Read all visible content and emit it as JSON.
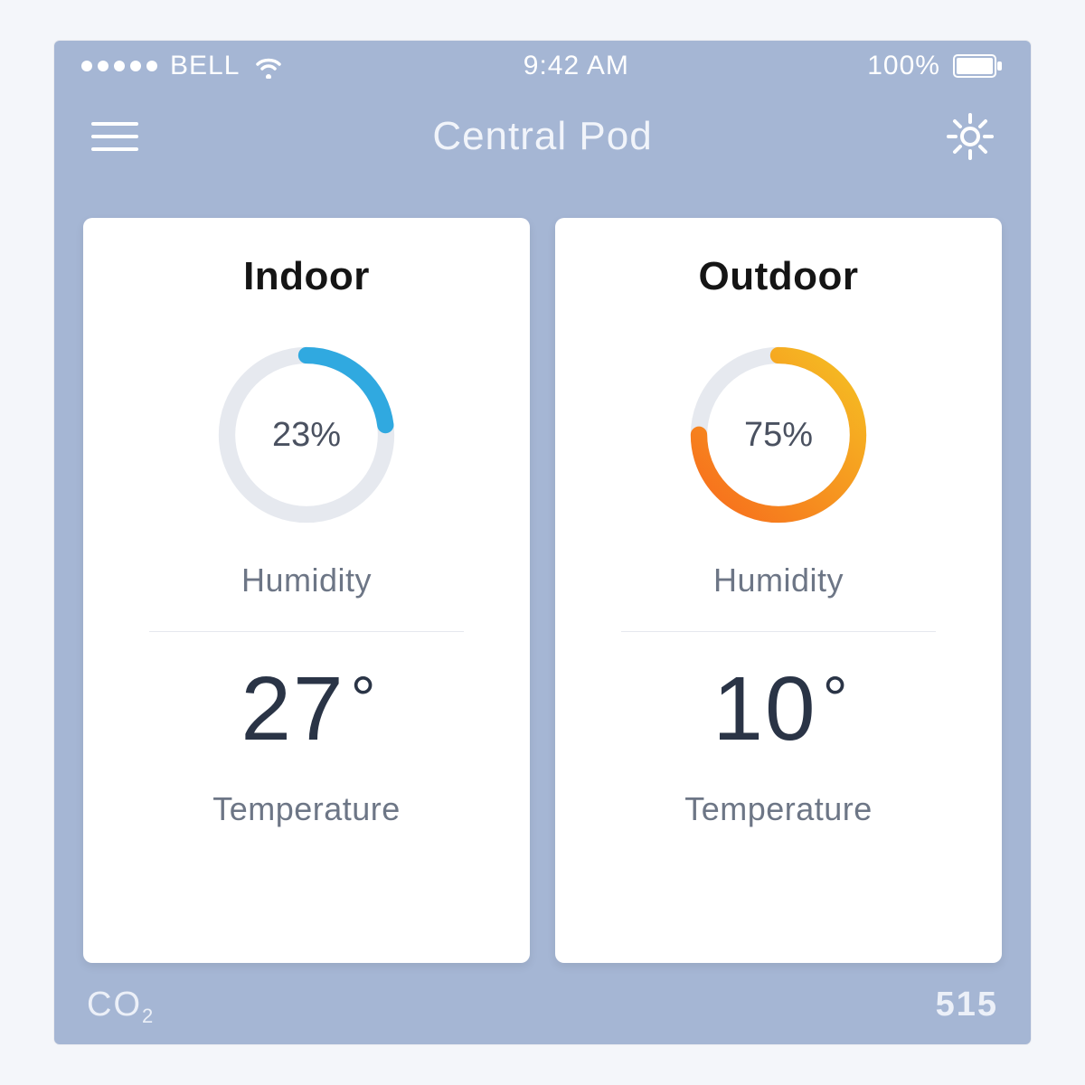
{
  "status": {
    "carrier": "BELL",
    "time": "9:42 AM",
    "battery": "100%"
  },
  "nav": {
    "title": "Central Pod"
  },
  "cards": {
    "indoor": {
      "title": "Indoor",
      "humidity_pct": 23,
      "humidity_display": "23%",
      "humidity_label": "Humidity",
      "temperature_value": "27",
      "temperature_label": "Temperature",
      "ring_color": "#30a9e0"
    },
    "outdoor": {
      "title": "Outdoor",
      "humidity_pct": 75,
      "humidity_display": "75%",
      "humidity_label": "Humidity",
      "temperature_value": "10",
      "temperature_label": "Temperature",
      "ring_color_start": "#f5a623",
      "ring_color_end": "#f76b1c"
    }
  },
  "footer": {
    "left_label": "CO",
    "left_sub": "2",
    "right_value": "515"
  },
  "colors": {
    "bg": "#a5b6d4",
    "card_bg": "#ffffff",
    "text_dark": "#2a3446",
    "text_muted": "#6d7686",
    "ring_track": "#e6e9ef"
  }
}
